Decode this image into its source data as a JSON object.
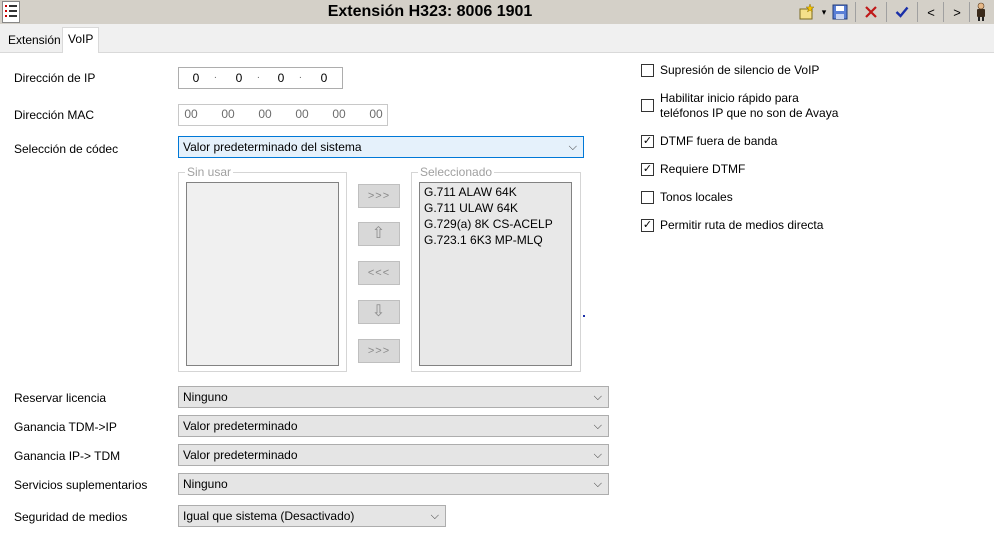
{
  "window": {
    "title": "Extensión H323: 8006 1901"
  },
  "toolbar": {
    "app_icon": "list-menu-icon",
    "new_icon": "new-item-icon",
    "save_icon": "save-icon",
    "cancel_icon": "cancel-x-icon",
    "ok_icon": "checkmark-icon",
    "prev_label": "<",
    "next_label": ">",
    "user_icon": "user-figure-icon"
  },
  "tabs": [
    {
      "label": "Extensión",
      "active": false
    },
    {
      "label": "VoIP",
      "active": true
    }
  ],
  "form": {
    "ip_label": "Dirección de IP",
    "ip": [
      "0",
      "0",
      "0",
      "0"
    ],
    "mac_label": "Dirección MAC",
    "mac": [
      "00",
      "00",
      "00",
      "00",
      "00",
      "00"
    ],
    "codec_label": "Selección de códec",
    "codec_value": "Valor predeterminado del sistema",
    "unused_title": "Sin usar",
    "selected_title": "Seleccionado",
    "selected_codecs": [
      "G.711 ALAW 64K",
      "G.711 ULAW 64K",
      "G.729(a) 8K CS-ACELP",
      "G.723.1 6K3 MP-MLQ"
    ],
    "buttons": {
      "add": ">>>",
      "up": "⇧",
      "remove": "<<<",
      "down": "⇩",
      "add_all": ">>>"
    },
    "reserve_label": "Reservar licencia",
    "reserve_value": "Ninguno",
    "gain_tdm_ip_label": "Ganancia TDM->IP",
    "gain_tdm_ip_value": "Valor predeterminado",
    "gain_ip_tdm_label": "Ganancia IP-> TDM",
    "gain_ip_tdm_value": "Valor predeterminado",
    "supp_services_label": "Servicios suplementarios",
    "supp_services_value": "Ninguno",
    "media_security_label": "Seguridad de medios",
    "media_security_value": "Igual que sistema (Desactivado)"
  },
  "options": [
    {
      "label": "Supresión de silencio de VoIP",
      "checked": false
    },
    {
      "label": "Habilitar inicio rápido para",
      "label2": "teléfonos IP que no son de Avaya",
      "checked": false
    },
    {
      "label": "DTMF fuera de banda",
      "checked": true
    },
    {
      "label": "Requiere DTMF",
      "checked": true
    },
    {
      "label": "Tonos locales",
      "checked": false
    },
    {
      "label": "Permitir ruta de medios directa",
      "checked": true
    }
  ]
}
